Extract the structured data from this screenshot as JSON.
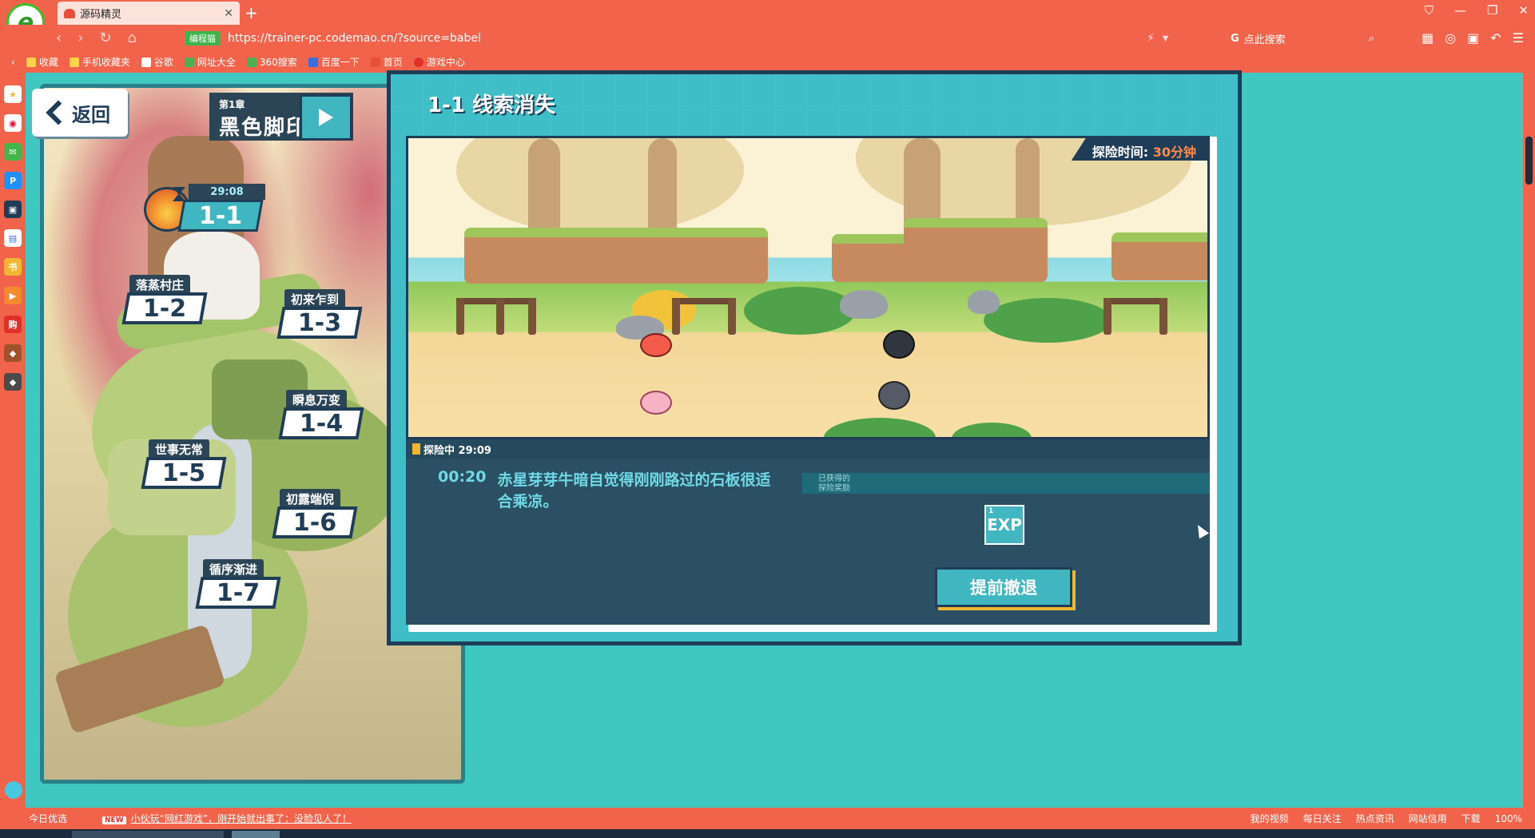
{
  "browser": {
    "tab_title": "源码精灵",
    "url": "https://trainer-pc.codemao.cn/?source=babel",
    "site_badge": "编程猫",
    "search_text": "点此搜索",
    "bookmarks": [
      "收藏",
      "手机收藏夹",
      "谷歌",
      "网址大全",
      "360搜索",
      "百度一下",
      "首页",
      "游戏中心"
    ],
    "status_left": "今日优选",
    "status_news": "小伙玩“网红游戏”，刚开始就出事了：没脸见人了！",
    "status_right": [
      "我的视频",
      "每日关注",
      "热点资讯",
      "网站信用",
      "下载",
      "100%"
    ]
  },
  "left": {
    "back_label": "返回",
    "chapter_num": "第1章",
    "chapter_title": "黑色脚印",
    "current": {
      "timer": "29:08",
      "num": "1-1"
    },
    "levels": [
      {
        "name": "落蒸村庄",
        "num": "1-2"
      },
      {
        "name": "初来乍到",
        "num": "1-3"
      },
      {
        "name": "瞬息万变",
        "num": "1-4"
      },
      {
        "name": "世事无常",
        "num": "1-5"
      },
      {
        "name": "初露端倪",
        "num": "1-6"
      },
      {
        "name": "循序渐进",
        "num": "1-7"
      }
    ]
  },
  "right": {
    "title": "1-1 线索消失",
    "explore_label": "探险时间:",
    "explore_value": "30分钟",
    "status_label": "探险中 29:09",
    "log_time": "00:20",
    "log_text": "赤星芽芽牛暗自觉得刚刚路过的石板很适合乘凉。",
    "reward_label_1": "已获得的",
    "reward_label_2": "探险奖励",
    "reward_count": "1",
    "reward_item": "EXP",
    "retreat_label": "提前撤退"
  },
  "colors": {
    "browser": "#f2634b",
    "panel": "#3fbec7",
    "dark": "#203d57",
    "accent": "#ff8a4a"
  }
}
